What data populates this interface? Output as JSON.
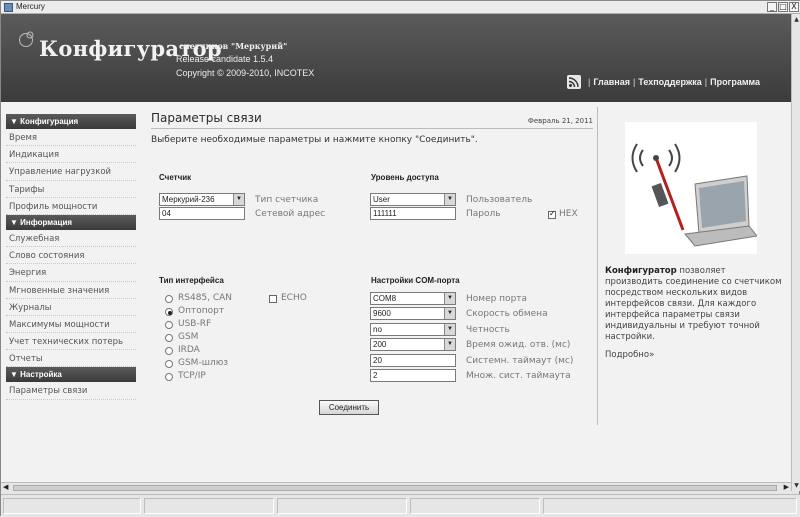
{
  "window": {
    "title": "Mercury",
    "controls": [
      "_",
      "□",
      "X"
    ]
  },
  "header": {
    "app_name": "Конфигуратор",
    "subtitle": "счетчиков \"Меркурий\"",
    "release": "Release candidate 1.5.4",
    "copyright": "Copyright © 2009-2010, INCOTEX",
    "nav": [
      "Главная",
      "Техподдержка",
      "Программа"
    ]
  },
  "sidebar": {
    "sections": [
      {
        "title": "▼ Конфигурация",
        "items": [
          "Время",
          "Индикация",
          "Управление нагрузкой",
          "Тарифы",
          "Профиль мощности"
        ]
      },
      {
        "title": "▼ Информация",
        "items": [
          "Служебная",
          "Слово состояния",
          "Энергия",
          "Мгновенные значения",
          "Журналы",
          "Максимумы мощности",
          "Учет технических потерь",
          "Отчеты"
        ]
      },
      {
        "title": "▼ Настройка",
        "items": [
          "Параметры связи"
        ]
      }
    ]
  },
  "main": {
    "title": "Параметры связи",
    "date": "Февраль 21, 2011",
    "intro": "Выберите необходимые параметры и нажмите кнопку \"Соединить\".",
    "meter": {
      "group_title": "Счетчик",
      "type_value": "Меркурий-236",
      "type_label": "Тип счетчика",
      "address_value": "04",
      "address_label": "Сетевой адрес"
    },
    "access": {
      "group_title": "Уровень доступа",
      "user_value": "User",
      "user_label": "Пользователь",
      "password_value": "111111",
      "password_label": "Пароль",
      "hex_label": "HEX",
      "hex_checked": true
    },
    "interface": {
      "group_title": "Тип интерфейса",
      "options": [
        "RS485, CAN",
        "Оптопорт",
        "USB-RF",
        "GSM",
        "IRDA",
        "GSM-шлюз",
        "TCP/IP"
      ],
      "selected": "Оптопорт",
      "echo_label": "ECHO",
      "echo_checked": false
    },
    "com": {
      "group_title": "Настройки COM-порта",
      "port_value": "COM8",
      "port_label": "Номер порта",
      "speed_value": "9600",
      "speed_label": "Скорость обмена",
      "parity_value": "no",
      "parity_label": "Четность",
      "wait_value": "200",
      "wait_label": "Время ожид. отв. (мс)",
      "systimeout_value": "20",
      "systimeout_label": "Системн. таймаут (мс)",
      "mult_value": "2",
      "mult_label": "Множ. сист. таймаута"
    },
    "connect_label": "Соединить"
  },
  "aside": {
    "bold_lead": "Конфигуратор",
    "text": " позволяет производить соединение со счетчиком посредством нескольких видов интерфейсов связи. Для каждого интерфейса параметры связи индивидуальны и требуют точной настройки.",
    "more": "Подробно»"
  },
  "colors": {
    "header_bg": "#464646",
    "content_bg": "#f2f2f2",
    "sidebar_head": "#464646"
  }
}
